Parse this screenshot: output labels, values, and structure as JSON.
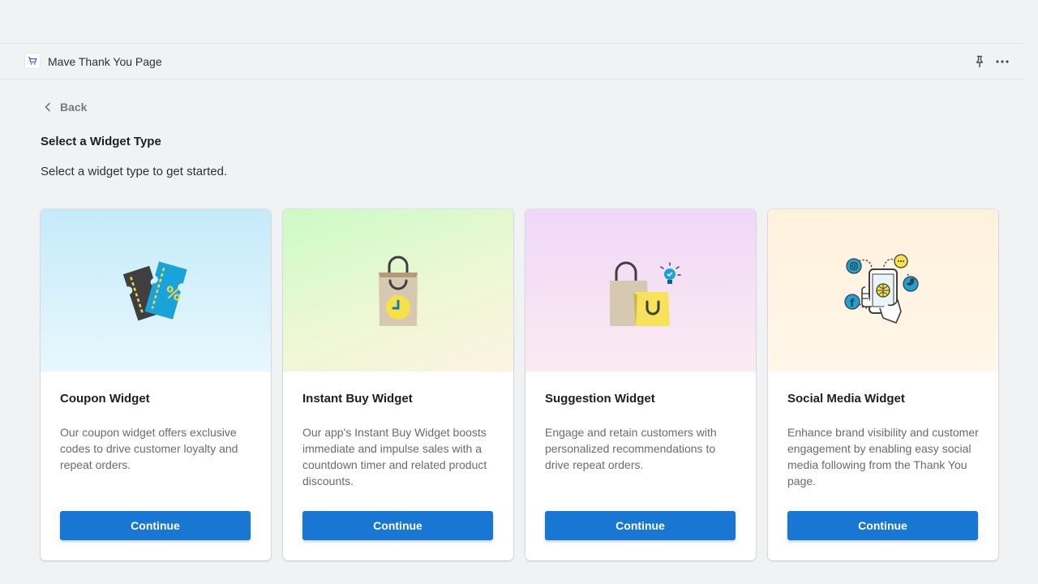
{
  "app": {
    "title": "Mave Thank You Page"
  },
  "nav": {
    "back_label": "Back"
  },
  "page": {
    "title": "Select a Widget Type",
    "subtitle": "Select a widget type to get started."
  },
  "cards": [
    {
      "title": "Coupon Widget",
      "description": "Our coupon widget offers exclusive codes to drive customer loyalty and repeat orders.",
      "button": "Continue",
      "icon": "coupon-tickets-icon"
    },
    {
      "title": "Instant Buy Widget",
      "description": "Our app's Instant Buy Widget boosts immediate and impulse sales with a countdown timer and related product discounts.",
      "button": "Continue",
      "icon": "shopping-bag-clock-icon"
    },
    {
      "title": "Suggestion Widget",
      "description": "Engage and retain customers with personalized recommendations to drive repeat orders.",
      "button": "Continue",
      "icon": "shopping-bags-lightbulb-icon"
    },
    {
      "title": "Social Media Widget",
      "description": "Enhance brand visibility and customer engagement by enabling easy social media following from the Thank You page.",
      "button": "Continue",
      "icon": "phone-social-icon"
    }
  ],
  "colors": {
    "primary_button": "#1976d2",
    "page_bg": "#f1f2f4"
  }
}
